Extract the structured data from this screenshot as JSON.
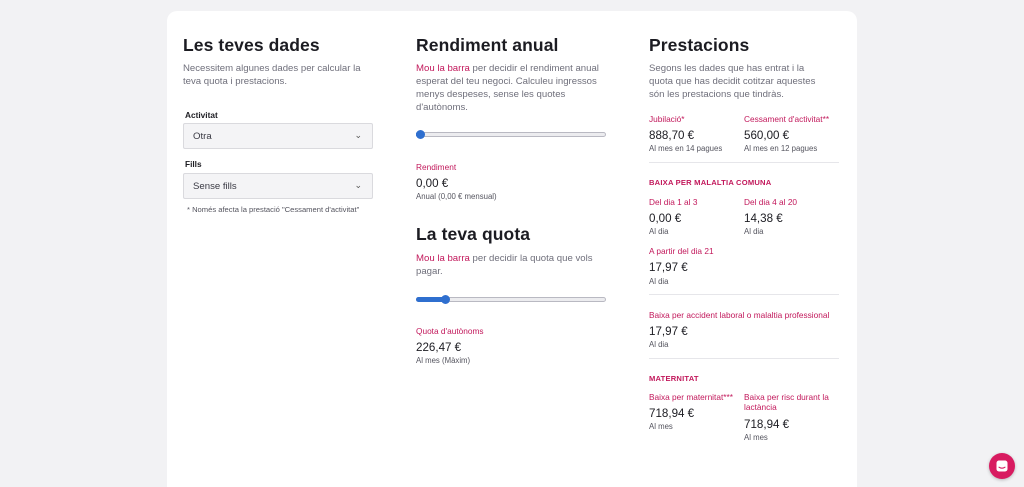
{
  "col1": {
    "title": "Les teves dades",
    "desc": "Necessitem algunes dades per calcular la teva quota i prestacions.",
    "activitat_label": "Activitat",
    "activitat_value": "Otra",
    "fills_label": "Fills",
    "fills_value": "Sense fills",
    "note": "* Només afecta la prestació \"Cessament d'activitat\""
  },
  "col2": {
    "title": "Rendiment anual",
    "desc_accent": "Mou la barra",
    "desc_rest": " per decidir el rendiment anual esperat del teu negoci. Calculeu ingressos menys despeses, sense les quotes d'autònoms.",
    "slider1_value": 0.0,
    "rendiment_label": "Rendiment",
    "rendiment_value": "0,00 €",
    "rendiment_sub": "Anual (0,00 € mensual)",
    "title2": "La teva quota",
    "desc2_accent": "Mou la barra",
    "desc2_rest": " per decidir la quota que vols pagar.",
    "slider2_value": 0.15,
    "quota_label": "Quota d'autònoms",
    "quota_value": "226,47 €",
    "quota_sub": "Al mes (Màxim)"
  },
  "col3": {
    "title": "Prestacions",
    "desc": "Segons les dades que has entrat i la quota que has decidit cotitzar aquestes són les prestacions que tindràs.",
    "jubilacio_label": "Jubilació*",
    "jubilacio_value": "888,70 €",
    "jubilacio_sub": "Al mes en 14 pagues",
    "cessament_label": "Cessament d'activitat**",
    "cessament_value": "560,00 €",
    "cessament_sub": "Al mes en 12 pagues",
    "baixa_heading": "BAIXA PER MALALTIA COMUNA",
    "d1_label": "Del dia 1 al 3",
    "d1_value": "0,00 €",
    "d1_sub": "Al dia",
    "d2_label": "Del dia 4 al 20",
    "d2_value": "14,38 €",
    "d2_sub": "Al dia",
    "d3_label": "A partir del dia 21",
    "d3_value": "17,97 €",
    "d3_sub": "Al dia",
    "accident_label": "Baixa per accident laboral o malaltia professional",
    "accident_value": "17,97 €",
    "accident_sub": "Al dia",
    "maternitat_heading": "MATERNITAT",
    "mat1_label": "Baixa per maternitat***",
    "mat1_value": "718,94 €",
    "mat1_sub": "Al mes",
    "mat2_label": "Baixa per risc durant la lactància",
    "mat2_value": "718,94 €",
    "mat2_sub": "Al mes"
  },
  "colors": {
    "accent": "#c2185b",
    "slider": "#2f6fcf",
    "chat": "#d81b60"
  }
}
